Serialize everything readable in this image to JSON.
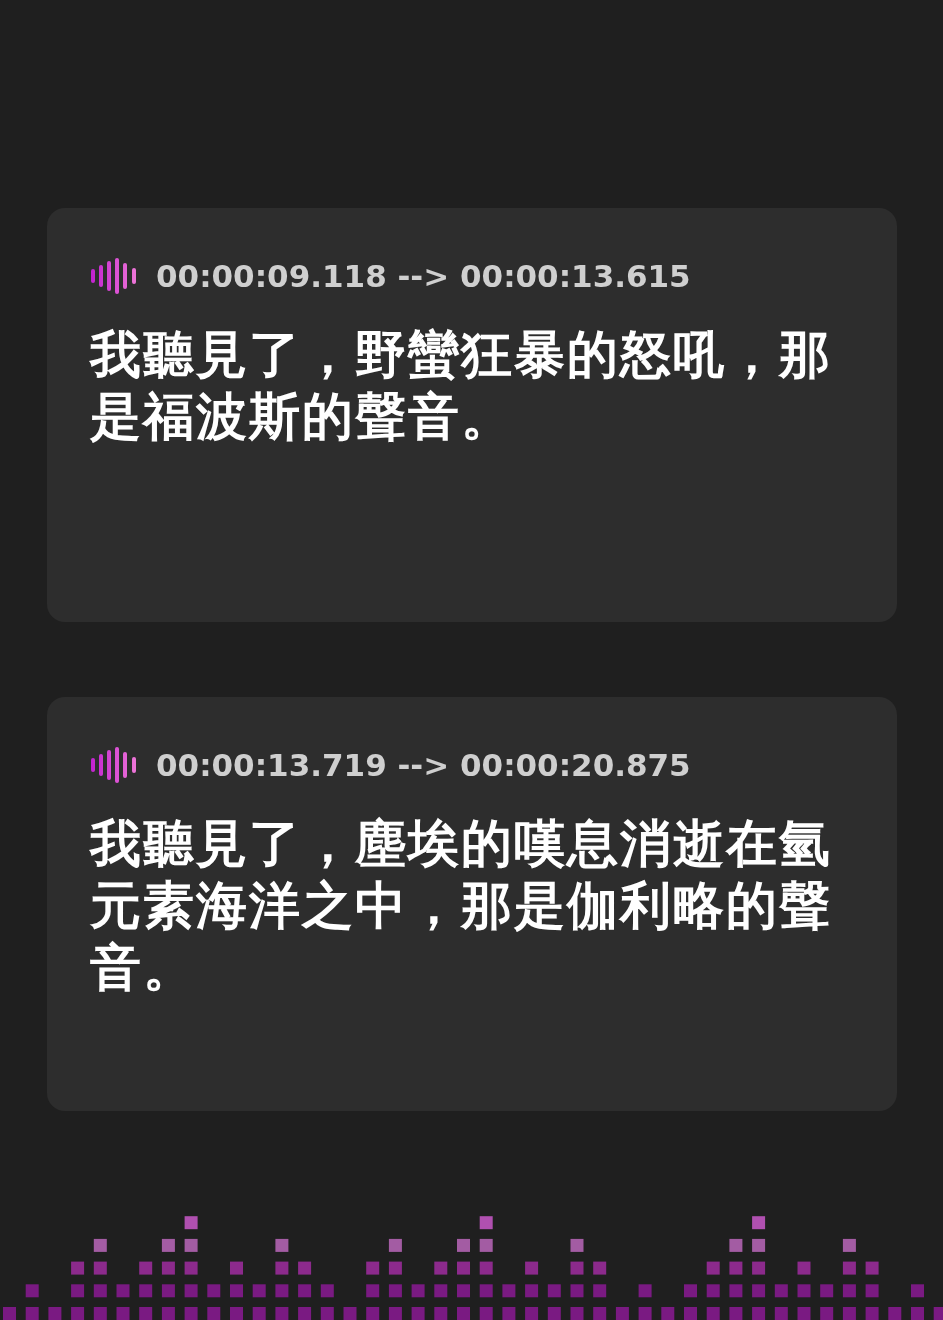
{
  "cues": [
    {
      "timestamp": "00:00:09.118 --> 00:00:13.615",
      "text": "我聽見了，野蠻狂暴的怒吼，那是福波斯的聲音。"
    },
    {
      "timestamp": "00:00:13.719 --> 00:00:20.875",
      "text": "我聽見了，塵埃的嘆息消逝在氫元素海洋之中，那是伽利略的聲音。"
    }
  ]
}
